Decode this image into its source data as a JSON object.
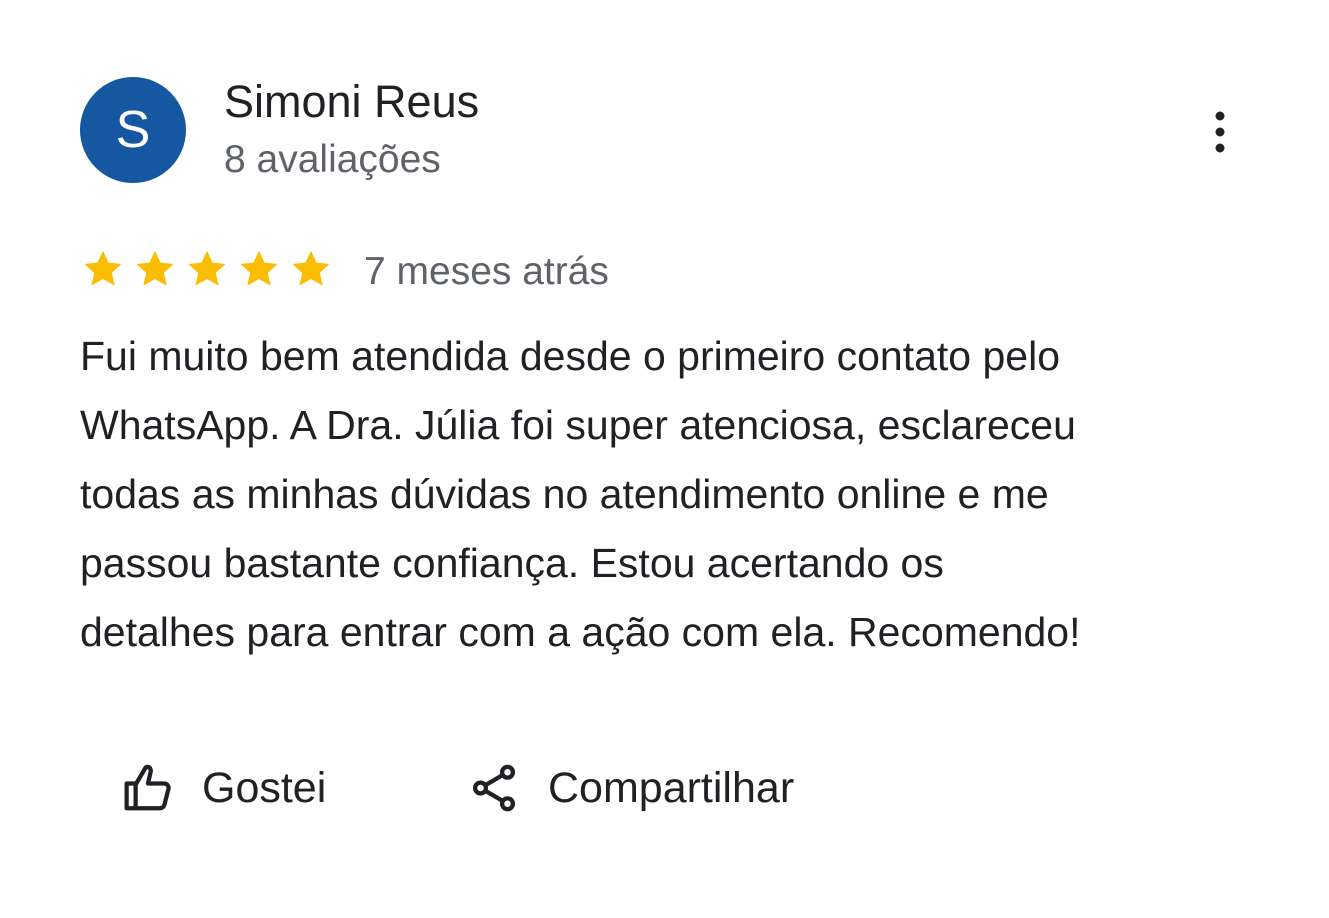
{
  "reviewer": {
    "avatar_initial": "S",
    "avatar_color": "#1557a0",
    "name": "Simoni Reus",
    "review_count": "8 avaliações"
  },
  "menu": {
    "icon": "more-vertical-icon"
  },
  "rating": {
    "stars": 5,
    "max_stars": 5,
    "star_color": "#fbbc04",
    "date": "7 meses atrás"
  },
  "review": {
    "lines": [
      "Fui muito bem atendida desde o primeiro contato pelo",
      "WhatsApp. A Dra. Júlia foi super atenciosa, esclareceu",
      "todas as minhas dúvidas no atendimento online e me",
      "passou bastante confiança. Estou acertando os",
      "detalhes para entrar com a ação com ela. Recomendo!"
    ]
  },
  "actions": {
    "like_label": "Gostei",
    "like_icon": "thumbs-up-icon",
    "share_label": "Compartilhar",
    "share_icon": "share-icon"
  }
}
